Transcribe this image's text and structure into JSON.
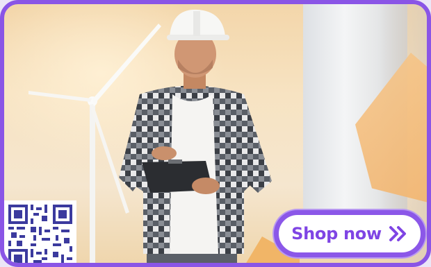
{
  "banner": {
    "cta_label": "Shop now",
    "cta_icon": "double-chevron-right-icon",
    "accent_color": "#8b57e8",
    "scene": {
      "subject": "engineer-in-hard-hat-with-clipboard",
      "background": "wind-turbines"
    },
    "qr_code": "qr-code-icon"
  }
}
